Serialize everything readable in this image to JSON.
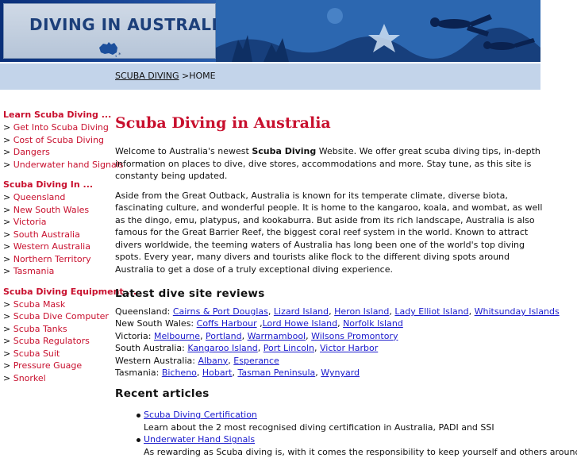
{
  "banner": {
    "title": "DIVING IN AUSTRALIA"
  },
  "breadcrumb": {
    "link": "SCUBA DIVING",
    "separator": ">",
    "current": "HOME"
  },
  "sidebar": {
    "sections": [
      {
        "heading": "Learn Scuba Diving ...",
        "items": [
          "Get Into Scuba Diving",
          "Cost of Scuba Diving",
          "Dangers",
          "Underwater hand Signals"
        ]
      },
      {
        "heading": "Scuba Diving In ...",
        "items": [
          "Queensland",
          "New South Wales",
          "Victoria",
          "South Australia",
          "Western Australia",
          "Northern Territory",
          "Tasmania"
        ]
      },
      {
        "heading": "Scuba Diving Equipment ...",
        "items": [
          "Scuba Mask",
          "Scuba Dive Computer",
          "Scuba Tanks",
          "Scuba Regulators",
          "Scuba Suit",
          "Pressure Guage",
          "Snorkel"
        ]
      }
    ],
    "arrow": ">"
  },
  "main": {
    "title": "Scuba Diving in Australia",
    "intro_before": "Welcome to Australia's newest ",
    "intro_bold": "Scuba Diving",
    "intro_after": " Website. We offer great scuba diving tips, in-depth information on places to dive, dive stores, accommodations and more. Stay tune, as this site is constanty being updated.",
    "para2": "Aside from the Great Outback, Australia is known for its temperate climate, diverse biota, fascinating culture, and wonderful people. It is home to the kangaroo, koala, and wombat, as well as the dingo, emu, platypus, and kookaburra. But aside from its rich landscape, Australia is also famous for the Great Barrier Reef, the biggest coral reef system in the world. Known to attract divers worldwide, the teeming waters of Australia has long been one of the world's top diving spots. Every year, many divers and tourists alike flock to the different diving spots around Australia to get a dose of a truly exceptional diving experience.",
    "reviews_heading": "Latest dive site reviews",
    "reviews": [
      {
        "state": "Queensland:",
        "sites": [
          "Cairns & Port Douglas",
          "Lizard Island",
          "Heron Island",
          "Lady Elliot Island",
          "Whitsunday Islands"
        ]
      },
      {
        "state": "New South Wales:",
        "sites": [
          "Coffs Harbour",
          "Lord Howe Island",
          "Norfolk Island"
        ]
      },
      {
        "state": "Victoria:",
        "sites": [
          "Melbourne",
          "Portland",
          "Warrnambool",
          "Wilsons Promontory"
        ]
      },
      {
        "state": "South Australia:",
        "sites": [
          "Kangaroo Island",
          "Port Lincoln",
          "Victor Harbor"
        ]
      },
      {
        "state": "Western Australia:",
        "sites": [
          "Albany",
          "Esperance"
        ]
      },
      {
        "state": "Tasmania:",
        "sites": [
          "Bicheno",
          "Hobart",
          "Tasman Peninsula",
          "Wynyard"
        ]
      }
    ],
    "articles_heading": "Recent articles",
    "articles": [
      {
        "title": "Scuba Diving Certification",
        "desc": "Learn about the 2 most recognised diving certification in Australia, PADI and SSI"
      },
      {
        "title": "Underwater Hand Signals",
        "desc": "As rewarding as Scuba diving is, with it comes the responsibility to keep yourself and others around"
      }
    ]
  },
  "colors": {
    "accent_red": "#c8102e",
    "link_blue": "#1a1acc",
    "crumb_bar": "#c3d4ea",
    "banner_blue": "#1f4fa0"
  }
}
